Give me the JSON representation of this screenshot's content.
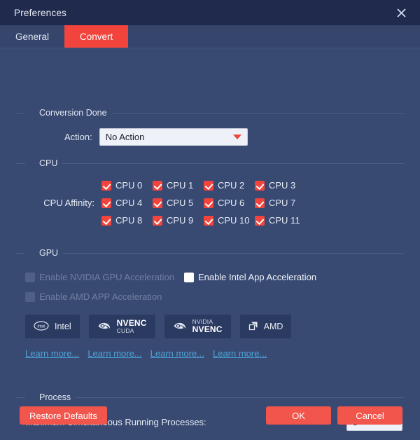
{
  "window": {
    "title": "Preferences",
    "close_icon": "close-x-icon"
  },
  "tabs": [
    {
      "label": "General",
      "active": false
    },
    {
      "label": "Convert",
      "active": true
    }
  ],
  "conversion_done": {
    "group_title": "Conversion Done",
    "action_label": "Action:",
    "action_value": "No Action",
    "dropdown_icon": "chevron-down-icon"
  },
  "cpu": {
    "group_title": "CPU",
    "affinity_label": "CPU Affinity:",
    "cores": [
      {
        "label": "CPU 0",
        "checked": true
      },
      {
        "label": "CPU 1",
        "checked": true
      },
      {
        "label": "CPU 2",
        "checked": true
      },
      {
        "label": "CPU 3",
        "checked": true
      },
      {
        "label": "CPU 4",
        "checked": true
      },
      {
        "label": "CPU 5",
        "checked": true
      },
      {
        "label": "CPU 6",
        "checked": true
      },
      {
        "label": "CPU 7",
        "checked": true
      },
      {
        "label": "CPU 8",
        "checked": true
      },
      {
        "label": "CPU 9",
        "checked": true
      },
      {
        "label": "CPU 10",
        "checked": true
      },
      {
        "label": "CPU 11",
        "checked": true
      }
    ]
  },
  "gpu": {
    "group_title": "GPU",
    "nvidia_label": "Enable NVIDIA GPU Acceleration",
    "intel_label": "Enable Intel App Acceleration",
    "amd_label": "Enable AMD APP Acceleration",
    "badges": [
      {
        "icon": "intel-logo-icon",
        "main": "Intel",
        "sub": ""
      },
      {
        "icon": "nvidia-eye-logo-icon",
        "main": "NVENC",
        "sub": "CUDA"
      },
      {
        "icon": "nvidia-eye-logo-icon",
        "main": "NVENC",
        "sub": "NVIDIA"
      },
      {
        "icon": "amd-arrow-logo-icon",
        "main": "AMD",
        "sub": ""
      }
    ],
    "links": [
      "Learn more...",
      "Learn more...",
      "Learn more...",
      "Learn more..."
    ]
  },
  "process": {
    "group_title": "Process",
    "max_processes_label": "Maximum Simultaneous Running Processes:",
    "max_processes_value": "8"
  },
  "footer": {
    "restore_label": "Restore Defaults",
    "ok_label": "OK",
    "cancel_label": "Cancel"
  },
  "colors": {
    "accent_red": "#f2443c",
    "button_red": "#f2554b",
    "titlebar": "#1f2a4d",
    "body": "#394a72",
    "tabstrip": "#35456c",
    "badge_bg": "#2b3a60",
    "link_blue": "#4aa3d8"
  }
}
